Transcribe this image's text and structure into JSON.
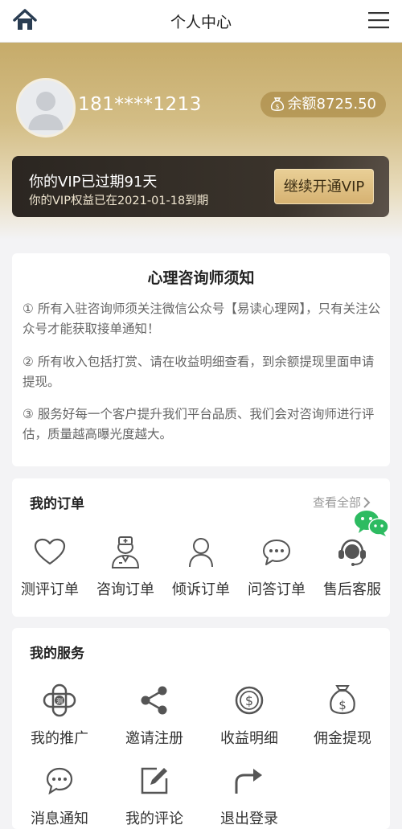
{
  "header": {
    "title": "个人中心"
  },
  "profile": {
    "phone": "181****1213",
    "balance": "余额8725.50"
  },
  "vip": {
    "title": "你的VIP已过期91天",
    "subtitle": "你的VIP权益已在2021-01-18到期",
    "button": "继续开通VIP"
  },
  "notice": {
    "title": "心理咨询师须知",
    "items": [
      "① 所有入驻咨询师须关注微信公众号【易读心理网】，只有关注公众号才能获取接单通知！",
      "② 所有收入包括打赏、请在收益明细查看，到余额提现里面申请提现。",
      "③ 服务好每一个客户提升我们平台品质、我们会对咨询师进行评估，质量越高曝光度越大。"
    ]
  },
  "orders": {
    "title": "我的订单",
    "view_all": "查看全部",
    "items": [
      {
        "label": "测评订单",
        "icon": "heart-icon"
      },
      {
        "label": "咨询订单",
        "icon": "doctor-icon"
      },
      {
        "label": "倾诉订单",
        "icon": "person-icon"
      },
      {
        "label": "问答订单",
        "icon": "chat-bubble-icon"
      },
      {
        "label": "售后客服",
        "icon": "headset-icon"
      }
    ]
  },
  "services": {
    "title": "我的服务",
    "items": [
      {
        "label": "我的推广",
        "icon": "promotion-icon"
      },
      {
        "label": "邀请注册",
        "icon": "share-icon"
      },
      {
        "label": "收益明细",
        "icon": "dollar-coin-icon"
      },
      {
        "label": "佣金提现",
        "icon": "money-bag-icon"
      },
      {
        "label": "消息通知",
        "icon": "message-icon"
      },
      {
        "label": "我的评论",
        "icon": "edit-icon"
      },
      {
        "label": "退出登录",
        "icon": "logout-arrow-icon"
      }
    ]
  },
  "colors": {
    "gold": "#c6ab6a",
    "vip_dark": "#2b2621",
    "wechat_green": "#2dbb61"
  }
}
